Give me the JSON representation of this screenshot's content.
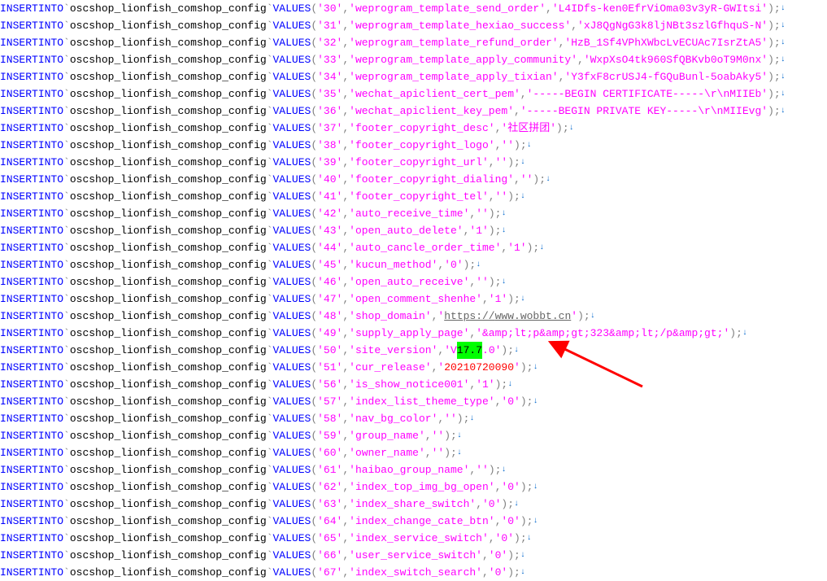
{
  "table_name": "oscshop_lionfish_comshop_config",
  "highlight_text": "17.7",
  "arrow": "↓",
  "semi": ";",
  "rows": [
    {
      "id": "30",
      "key": "weprogram_template_send_order",
      "val": "L4IDfs-ken0EfrViOma03v3yR-GWItsi"
    },
    {
      "id": "31",
      "key": "weprogram_template_hexiao_success",
      "val": "xJ8QgNgG3k8ljNBt3szlGfhquS-N"
    },
    {
      "id": "32",
      "key": "weprogram_template_refund_order",
      "val": "HzB_1Sf4VPhXWbcLvECUAc7IsrZtA5"
    },
    {
      "id": "33",
      "key": "weprogram_template_apply_community",
      "val": "WxpXsO4tk960SfQBKvb0oT9M0nx"
    },
    {
      "id": "34",
      "key": "weprogram_template_apply_tixian",
      "val": "Y3fxF8crUSJ4-fGQuBunl-5oabAky5"
    },
    {
      "id": "35",
      "key": "wechat_apiclient_cert_pem",
      "val": "-----BEGIN CERTIFICATE-----\\r\\nMIIEb"
    },
    {
      "id": "36",
      "key": "wechat_apiclient_key_pem",
      "val": "-----BEGIN PRIVATE KEY-----\\r\\nMIIEvg"
    },
    {
      "id": "37",
      "key": "footer_copyright_desc",
      "val_display": "社区拼团"
    },
    {
      "id": "38",
      "key": "footer_copyright_logo",
      "val": ""
    },
    {
      "id": "39",
      "key": "footer_copyright_url",
      "val": ""
    },
    {
      "id": "40",
      "key": "footer_copyright_dialing",
      "val": ""
    },
    {
      "id": "41",
      "key": "footer_copyright_tel",
      "val": ""
    },
    {
      "id": "42",
      "key": "auto_receive_time",
      "val": ""
    },
    {
      "id": "43",
      "key": "open_auto_delete",
      "val": "1"
    },
    {
      "id": "44",
      "key": "auto_cancle_order_time",
      "val": "1"
    },
    {
      "id": "45",
      "key": "kucun_method",
      "val": "0"
    },
    {
      "id": "46",
      "key": "open_auto_receive",
      "val": ""
    },
    {
      "id": "47",
      "key": "open_comment_shenhe",
      "val": "1"
    },
    {
      "id": "48",
      "key": "shop_domain",
      "val_display": "https:// ",
      "domain_wm": "www.wobbt.cn "
    },
    {
      "id": "49",
      "key": "supply_apply_page",
      "val": "&amp;lt;p&amp;gt;323&amp;lt;/p&amp;gt;"
    },
    {
      "id": "50",
      "key": "site_version",
      "val_prefix": "V",
      "val_hl": "17.7",
      "val_suffix": ".0"
    },
    {
      "id": "51",
      "key": "cur_release",
      "val": "20210720090",
      "redfn": true
    },
    {
      "id": "56",
      "key": "is_show_notice001",
      "val": "1"
    },
    {
      "id": "57",
      "key": "index_list_theme_type",
      "val": "0"
    },
    {
      "id": "58",
      "key": "nav_bg_color",
      "val": ""
    },
    {
      "id": "59",
      "key": "group_name",
      "val": ""
    },
    {
      "id": "60",
      "key": "owner_name",
      "val": ""
    },
    {
      "id": "61",
      "key": "haibao_group_name",
      "val": ""
    },
    {
      "id": "62",
      "key": "index_top_img_bg_open",
      "val": "0"
    },
    {
      "id": "63",
      "key": "index_share_switch",
      "val": "0"
    },
    {
      "id": "64",
      "key": "index_change_cate_btn",
      "val": "0"
    },
    {
      "id": "65",
      "key": "index_service_switch",
      "val": "0"
    },
    {
      "id": "66",
      "key": "user_service_switch",
      "val": "0"
    },
    {
      "id": "67",
      "key": "index_switch_search",
      "val": "0"
    }
  ]
}
